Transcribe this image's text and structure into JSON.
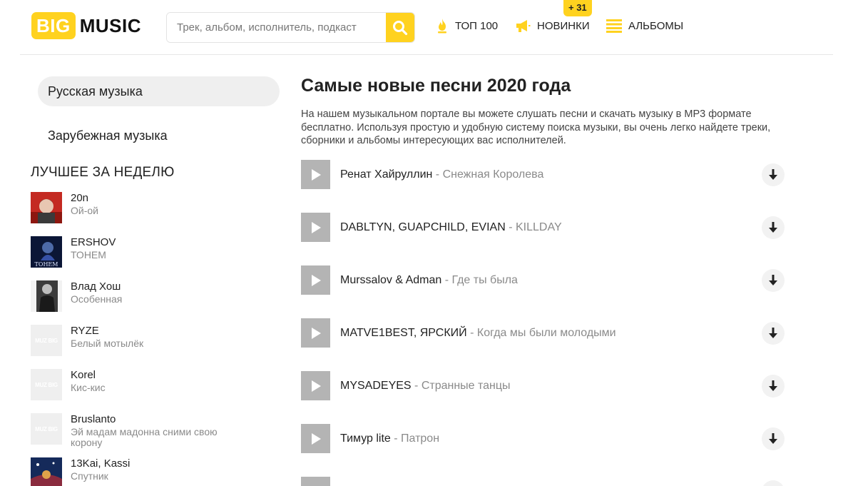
{
  "header": {
    "logo": {
      "big": "BIG",
      "music": "MUSIC"
    },
    "search": {
      "placeholder": "Трек, альбом, исполнитель, подкаст",
      "value": ""
    },
    "nav": [
      {
        "label": "ТОП 100",
        "icon": "flame-icon"
      },
      {
        "label": "НОВИНКИ",
        "icon": "megaphone-icon"
      },
      {
        "label": "АЛЬБОМЫ",
        "icon": "albums-icon"
      }
    ],
    "new_badge": "+ 31",
    "accent_color": "#ffd21f"
  },
  "sidebar": {
    "categories": [
      {
        "label": "Русская музыка",
        "active": true
      },
      {
        "label": "Зарубежная музыка",
        "active": false
      }
    ],
    "week_title": "ЛУЧШЕЕ ЗА НЕДЕЛЮ",
    "week": [
      {
        "artist": "20n",
        "title": "Ой-ой",
        "cover": "cover-red"
      },
      {
        "artist": "ERSHOV",
        "title": "ТОНЕМ",
        "cover": "cover-blue",
        "cover_text": "ТОНЕМ"
      },
      {
        "artist": "Влад Хош",
        "title": "Особенная",
        "cover": "cover-bw"
      },
      {
        "artist": "RYZE",
        "title": "Белый мотылёк",
        "cover": "placeholder"
      },
      {
        "artist": "Korel",
        "title": "Кис-кис",
        "cover": "placeholder"
      },
      {
        "artist": "Bruslanto",
        "title": "Эй мадам мадонна сними свою корону",
        "cover": "placeholder"
      },
      {
        "artist": "13Kai, Kassi",
        "title": "Спутник",
        "cover": "cover-space"
      }
    ]
  },
  "main": {
    "title": "Самые новые песни 2020 года",
    "intro": "На нашем музыкальном портале вы можете слушать песни и скачать музыку в MP3 формате бесплатно. Используя простую и удобную систему поиска музыки, вы очень легко найдете треки, сборники и альбомы интересующих вас исполнителей.",
    "separator": " - ",
    "tracks": [
      {
        "artist": "Ренат Хайруллин",
        "song": "Снежная Королева"
      },
      {
        "artist": "DABLTYN, GUAPCHILD, EVIAN",
        "song": "KILLDAY"
      },
      {
        "artist": "Murssalov & Adman",
        "song": "Где ты была"
      },
      {
        "artist": "MATVE1BEST, ЯРСКИЙ",
        "song": "Когда мы были молодыми"
      },
      {
        "artist": "MYSADEYES",
        "song": "Странные танцы"
      },
      {
        "artist": "Тимур lite",
        "song": "Патрон"
      }
    ]
  }
}
